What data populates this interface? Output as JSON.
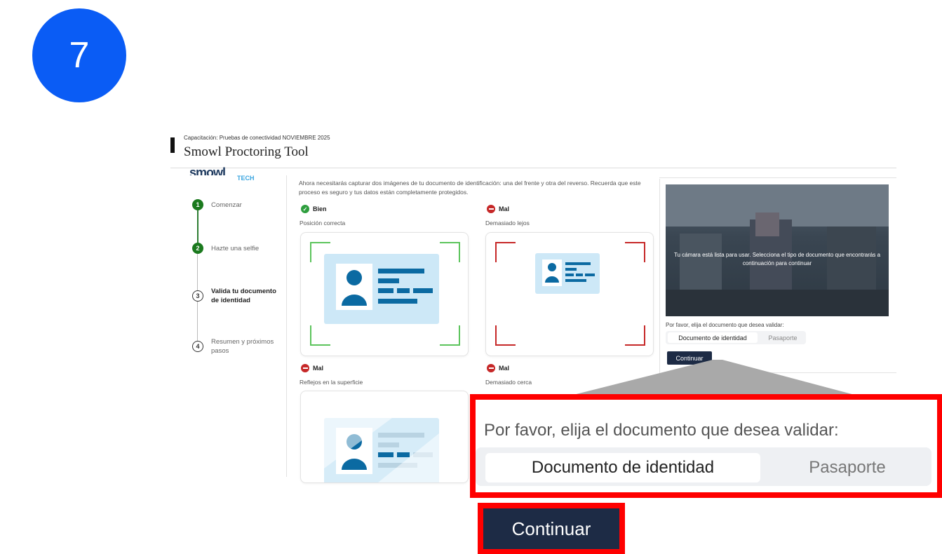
{
  "step_number": "7",
  "header": {
    "course": "Capacitación: Pruebas de conectividad NOVIEMBRE 2025",
    "title": "Smowl Proctoring Tool"
  },
  "logo": {
    "name": "smowl",
    "sub": "TECH"
  },
  "stepper": [
    {
      "num": "1",
      "label": "Comenzar",
      "state": "done"
    },
    {
      "num": "2",
      "label": "Hazte una selfie",
      "state": "done"
    },
    {
      "num": "3",
      "label": "Valida tu documento de identidad",
      "state": "active"
    },
    {
      "num": "4",
      "label": "Resumen y próximos pasos",
      "state": "pending"
    }
  ],
  "intro": "Ahora necesitarás capturar dos imágenes de tu documento de identificación: una del frente y otra del reverso. Recuerda que este proceso es seguro y tus datos están completamente protegidos.",
  "examples": [
    {
      "verdict": "Bien",
      "caption": "Posición correcta",
      "good": true
    },
    {
      "verdict": "Mal",
      "caption": "Demasiado lejos",
      "good": false
    },
    {
      "verdict": "Mal",
      "caption": "Reflejos en la superficie",
      "good": false
    },
    {
      "verdict": "Mal",
      "caption": "Demasiado cerca",
      "good": false
    }
  ],
  "camera": {
    "message": "Tu cámara está lista para usar. Selecciona el tipo de documento que encontrarás a continuación para continuar"
  },
  "document_choice": {
    "label": "Por favor, elija el documento que desea validar:",
    "options": [
      "Documento de identidad",
      "Pasaporte"
    ],
    "selected": "Documento de identidad"
  },
  "continue_label": "Continuar",
  "colors": {
    "badge": "#0a5cf5",
    "highlight": "#ff0000",
    "button": "#1d2b45",
    "good": "#2e9e3e",
    "bad": "#c62828",
    "card_art": "#0b6aa2"
  }
}
